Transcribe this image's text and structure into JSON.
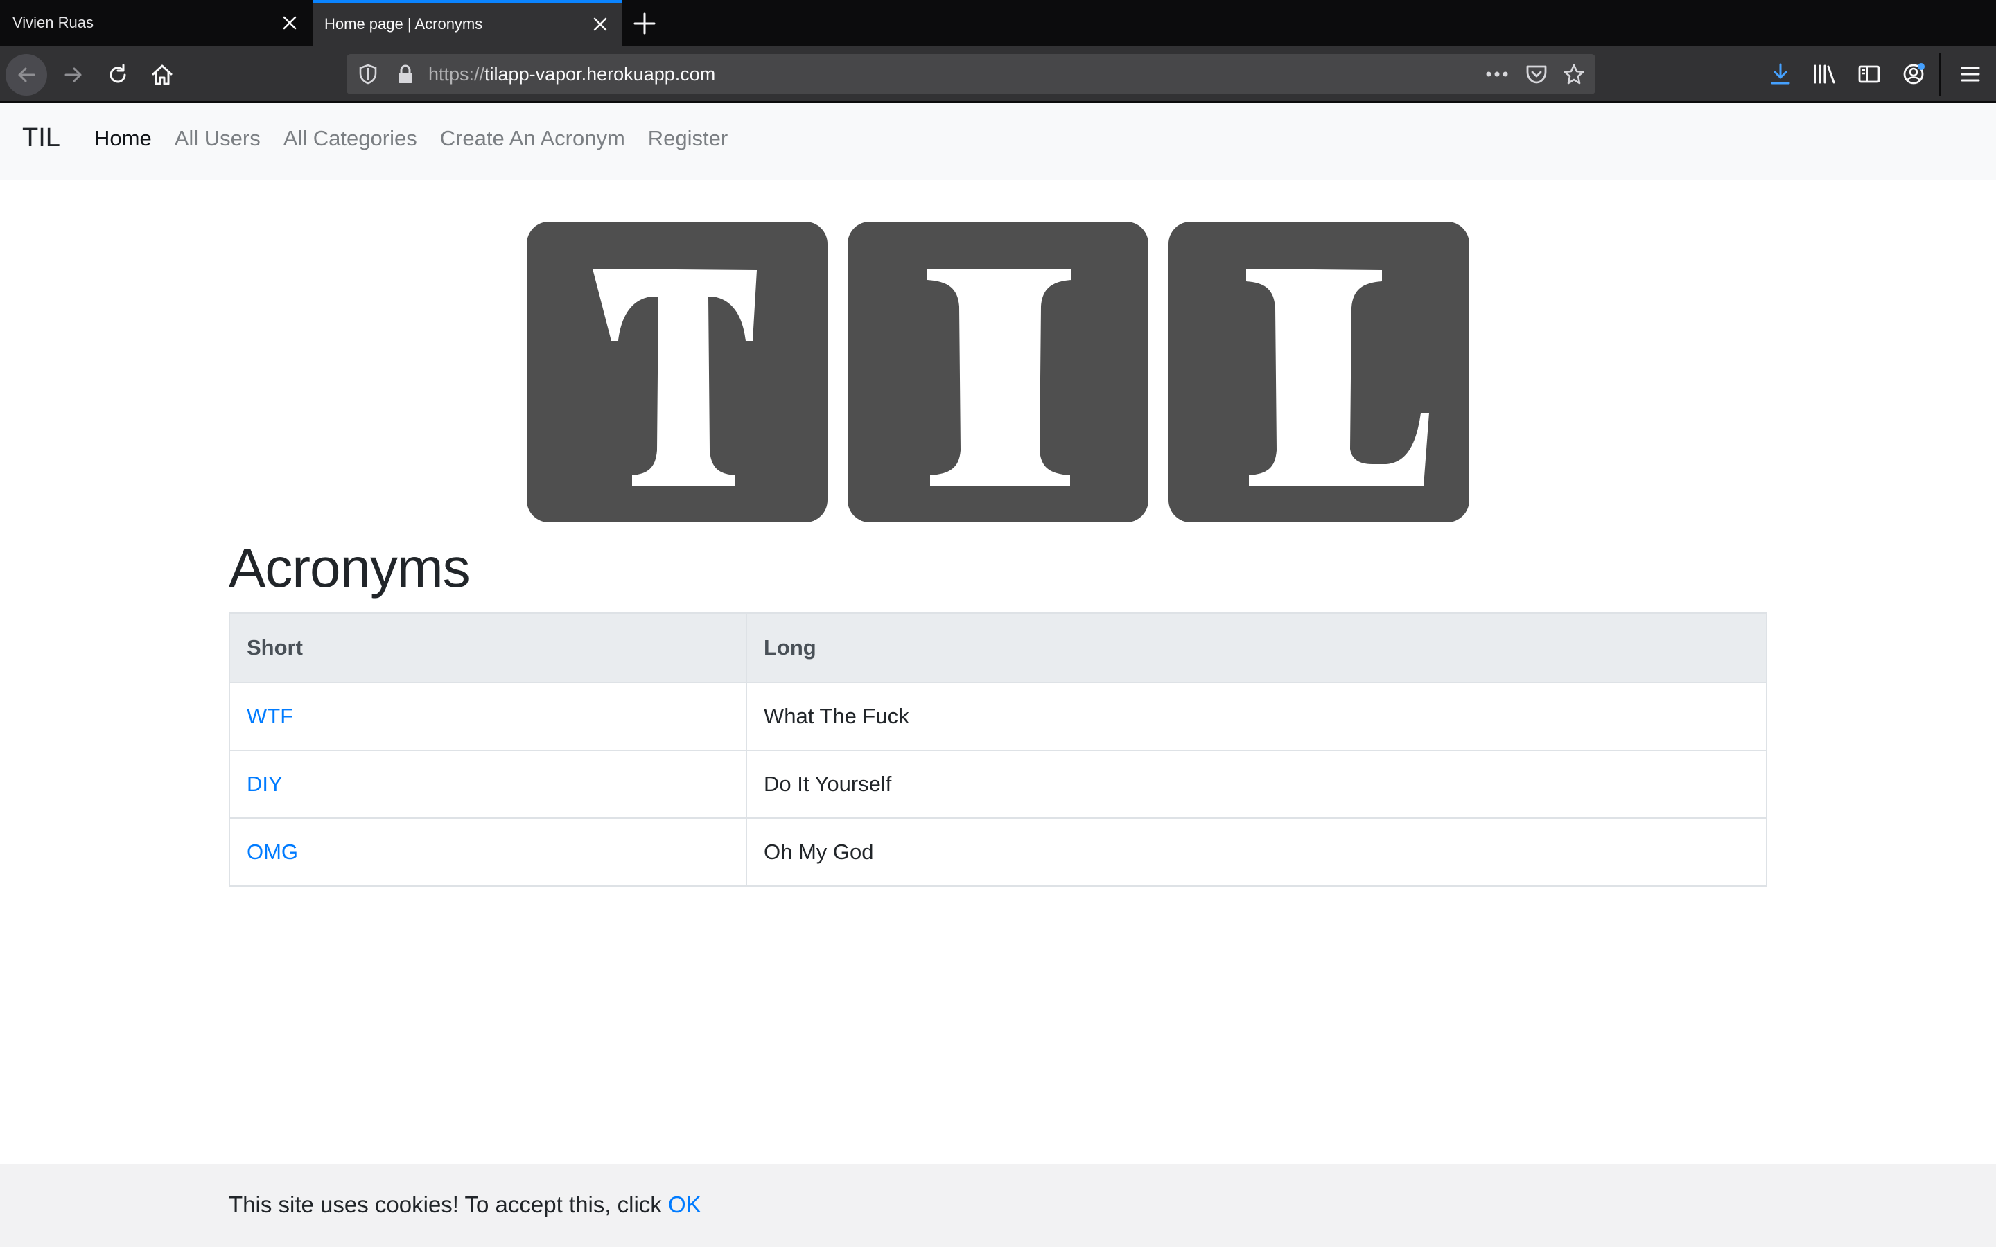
{
  "browser": {
    "tabs": [
      {
        "title": "Vivien Ruas",
        "active": false
      },
      {
        "title": "Home page | Acronyms",
        "active": true
      }
    ],
    "url_scheme": "https://",
    "url_host": "tilapp-vapor.herokuapp.com",
    "accent_color": "#0a84ff",
    "icons": [
      "close-icon",
      "plus-icon",
      "back-arrow-icon",
      "forward-arrow-icon",
      "reload-icon",
      "home-icon",
      "shield-icon",
      "lock-icon",
      "more-icon",
      "pocket-icon",
      "star-icon",
      "download-icon",
      "library-icon",
      "sidebar-icon",
      "account-icon",
      "menu-icon"
    ]
  },
  "site_nav": {
    "brand": "TIL",
    "links": [
      {
        "label": "Home",
        "active": true
      },
      {
        "label": "All Users",
        "active": false
      },
      {
        "label": "All Categories",
        "active": false
      },
      {
        "label": "Create An Acronym",
        "active": false
      },
      {
        "label": "Register",
        "active": false
      }
    ]
  },
  "logo": {
    "letters": [
      "T",
      "I",
      "L"
    ]
  },
  "main": {
    "title": "Acronyms",
    "table": {
      "headers": [
        "Short",
        "Long"
      ],
      "rows": [
        {
          "short": "WTF",
          "long": "What The Fuck"
        },
        {
          "short": "DIY",
          "long": "Do It Yourself"
        },
        {
          "short": "OMG",
          "long": "Oh My God"
        }
      ]
    }
  },
  "cookie_banner": {
    "text": "This site uses cookies! To accept this, click ",
    "link": "OK"
  },
  "colors": {
    "link": "#007bff",
    "tile": "#4f4f4f"
  }
}
